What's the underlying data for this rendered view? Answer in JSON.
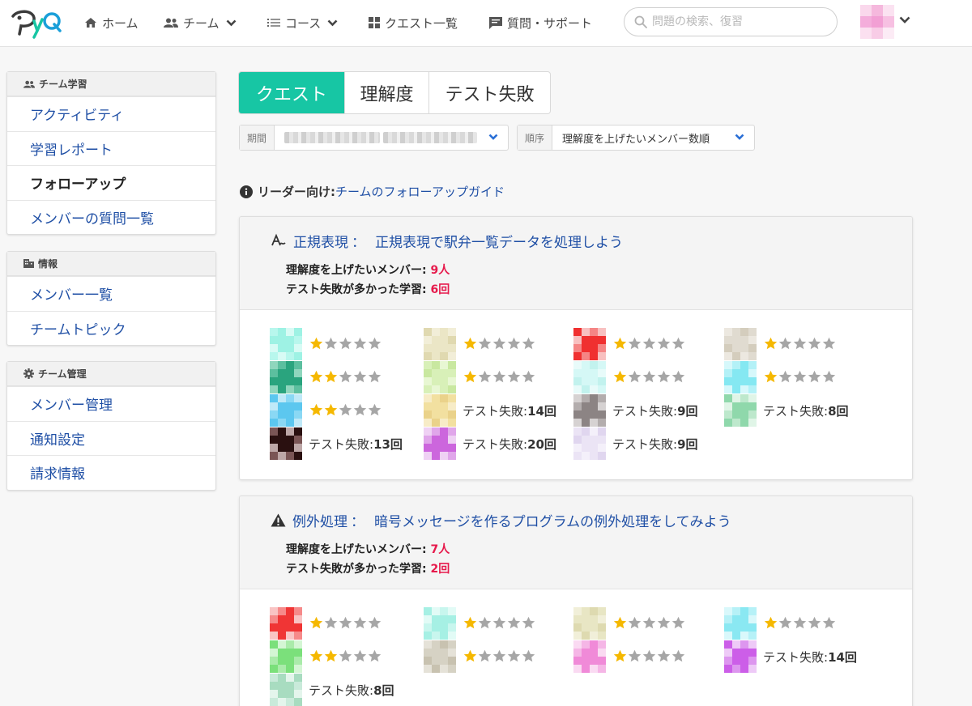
{
  "header": {
    "logo_alt": "PyQ",
    "nav": [
      {
        "label": "ホーム",
        "icon": "home-icon"
      },
      {
        "label": "チーム",
        "icon": "team-icon",
        "dropdown": true
      },
      {
        "label": "コース",
        "icon": "list-icon",
        "dropdown": true
      },
      {
        "label": "クエスト一覧",
        "icon": "grid-icon"
      },
      {
        "label": "質問・サポート",
        "icon": "chat-icon"
      }
    ],
    "search_placeholder": "問題の検索、復習"
  },
  "sidebar": [
    {
      "heading": "チーム学習",
      "icon": "team-icon",
      "items": [
        "アクティビティ",
        "学習レポート",
        "フォローアップ",
        "メンバーの質問一覧"
      ],
      "active": 2
    },
    {
      "heading": "情報",
      "icon": "info-building-icon",
      "items": [
        "メンバー一覧",
        "チームトピック"
      ],
      "active": -1
    },
    {
      "heading": "チーム管理",
      "icon": "gear-icon",
      "items": [
        "メンバー管理",
        "通知設定",
        "請求情報"
      ],
      "active": -1
    }
  ],
  "tabs": [
    {
      "label": "クエスト",
      "active": true
    },
    {
      "label": "理解度",
      "active": false
    },
    {
      "label": "テスト失敗",
      "active": false
    }
  ],
  "filters": {
    "period_label": "期間",
    "order_label": "順序",
    "order_value": "理解度を上げたいメンバー数順"
  },
  "leader": {
    "label": "リーダー向け:",
    "link": "チームのフォローアップガイド"
  },
  "colors": {
    "accent": "#17c6a4",
    "link": "#1f4fa5",
    "highlight": "#e6194b",
    "star_on": "#f5b800",
    "star_off": "#a6a6a6"
  },
  "quests": [
    {
      "icon": "regex-icon",
      "category": "正規表現",
      "colon": "：",
      "title": "正規表現で駅弁一覧データを処理しよう",
      "members_label": "理解度を上げたいメンバー:",
      "members_count": "9人",
      "fails_label": "テスト失敗が多かった学習:",
      "fails_count": "6回",
      "columns": [
        [
          {
            "avatar": [
              "#9ef2e4",
              "#b8f7ed",
              "#d8fbf5"
            ],
            "stars": 1
          },
          {
            "avatar": [
              "#2aa47e",
              "#5cbf9f",
              "#8fd6bd"
            ],
            "stars": 2
          },
          {
            "avatar": [
              "#5cc7ef",
              "#8ad8f4",
              "#bfe9f8"
            ],
            "stars": 2
          },
          {
            "avatar": [
              "#2a1010",
              "#7a5555",
              "#bda7a7"
            ],
            "fail_label": "テスト失敗:",
            "fail_count": "13回"
          }
        ],
        [
          {
            "avatar": [
              "#ebe6c6",
              "#f2eed8",
              "#e0d9b0"
            ],
            "stars": 1
          },
          {
            "avatar": [
              "#d8f0b8",
              "#e8f7d3",
              "#c9e8a0"
            ],
            "stars": 1
          },
          {
            "avatar": [
              "#f2e0a0",
              "#f7ecc7",
              "#ead28a"
            ],
            "fail_label": "テスト失敗:",
            "fail_count": "14回"
          },
          {
            "avatar": [
              "#cc66dd",
              "#e0a6ea",
              "#efd1f4"
            ],
            "fail_label": "テスト失敗:",
            "fail_count": "20回"
          }
        ],
        [
          {
            "avatar": [
              "#f03030",
              "#f58585",
              "#f8c0c0"
            ],
            "stars": 1
          },
          {
            "avatar": [
              "#d5f8f6",
              "#e8fbfa",
              "#c2f2ee"
            ],
            "stars": 1
          },
          {
            "avatar": [
              "#8c8484",
              "#b3adad",
              "#d6d2d2"
            ],
            "fail_label": "テスト失敗:",
            "fail_count": "9回"
          },
          {
            "avatar": [
              "#ebe4f5",
              "#f4f0fa",
              "#e0d6ef"
            ],
            "fail_label": "テスト失敗:",
            "fail_count": "9回"
          }
        ],
        [
          {
            "avatar": [
              "#e0dbd0",
              "#ece8e0",
              "#d4cdbd"
            ],
            "stars": 1
          },
          {
            "avatar": [
              "#85e8f2",
              "#b3f1f7",
              "#d6f8fb"
            ],
            "stars": 1
          },
          {
            "avatar": [
              "#8fd8ab",
              "#bde8cc",
              "#e0f5e7"
            ],
            "fail_label": "テスト失敗:",
            "fail_count": "8回"
          }
        ]
      ]
    },
    {
      "icon": "warning-icon",
      "category": "例外処理",
      "colon": "：",
      "title": "暗号メッセージを作るプログラムの例外処理をしてみよう",
      "members_label": "理解度を上げたいメンバー:",
      "members_count": "7人",
      "fails_label": "テスト失敗が多かった学習:",
      "fails_count": "2回",
      "columns": [
        [
          {
            "avatar": [
              "#f03535",
              "#f68a8a",
              "#f9c4c4"
            ],
            "stars": 1
          },
          {
            "avatar": [
              "#7be07b",
              "#aaebaa",
              "#d4f6d4"
            ],
            "stars": 2
          },
          {
            "avatar": [
              "#a8dcc0",
              "#c9eada",
              "#e4f5ec"
            ],
            "fail_label": "テスト失敗:",
            "fail_count": "8回"
          }
        ],
        [
          {
            "avatar": [
              "#a6f0e4",
              "#c8f6ee",
              "#e2fbf6"
            ],
            "stars": 1
          },
          {
            "avatar": [
              "#d6d2c4",
              "#e5e2d8",
              "#c8c2b0"
            ],
            "stars": 1
          }
        ],
        [
          {
            "avatar": [
              "#e8e6c4",
              "#f1efd9",
              "#dedab0"
            ],
            "stars": 1
          },
          {
            "avatar": [
              "#f08ad8",
              "#f5b6e6",
              "#fadaf2"
            ],
            "stars": 1
          }
        ],
        [
          {
            "avatar": [
              "#8ae8f2",
              "#b6f1f7",
              "#d9f8fb"
            ],
            "stars": 1
          },
          {
            "avatar": [
              "#cc5ee8",
              "#dd96ef",
              "#eecaf7"
            ],
            "fail_label": "テスト失敗:",
            "fail_count": "14回"
          }
        ]
      ]
    }
  ]
}
